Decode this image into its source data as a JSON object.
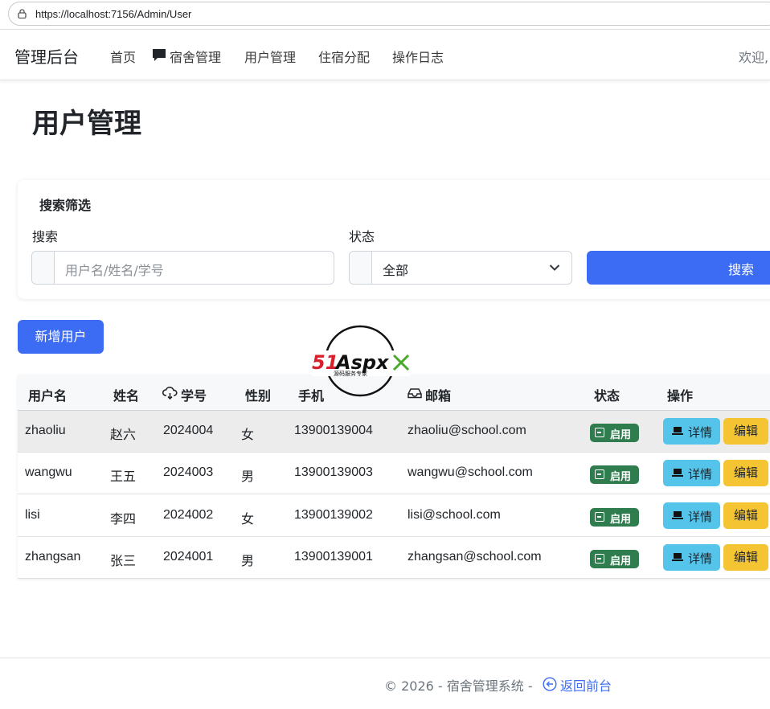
{
  "browser": {
    "url": "https://localhost:7156/Admin/User"
  },
  "navbar": {
    "brand": "管理后台",
    "items": [
      {
        "label": "首页",
        "icon": ""
      },
      {
        "label": "宿舍管理",
        "icon": "chat-bubble-icon"
      },
      {
        "label": "用户管理",
        "icon": ""
      },
      {
        "label": "住宿分配",
        "icon": ""
      },
      {
        "label": "操作日志",
        "icon": ""
      }
    ],
    "welcome": "欢迎,"
  },
  "page": {
    "title": "用户管理"
  },
  "filter": {
    "title": "搜索筛选",
    "search_label": "搜索",
    "search_placeholder": "用户名/姓名/学号",
    "status_label": "状态",
    "status_value": "全部",
    "search_button": "搜索"
  },
  "actions": {
    "add_user": "新增用户"
  },
  "table": {
    "headers": {
      "username": "用户名",
      "name": "姓名",
      "student_id": "学号",
      "gender": "性别",
      "phone": "手机",
      "email": "邮箱",
      "status": "状态",
      "ops": "操作"
    },
    "rows": [
      {
        "username": "zhaoliu",
        "name": "赵六",
        "student_id": "2024004",
        "gender": "女",
        "phone": "13900139004",
        "email": "zhaoliu@school.com",
        "status": "启用",
        "detail": "详情",
        "edit": "编辑"
      },
      {
        "username": "wangwu",
        "name": "王五",
        "student_id": "2024003",
        "gender": "男",
        "phone": "13900139003",
        "email": "wangwu@school.com",
        "status": "启用",
        "detail": "详情",
        "edit": "编辑"
      },
      {
        "username": "lisi",
        "name": "李四",
        "student_id": "2024002",
        "gender": "女",
        "phone": "13900139002",
        "email": "lisi@school.com",
        "status": "启用",
        "detail": "详情",
        "edit": "编辑"
      },
      {
        "username": "zhangsan",
        "name": "张三",
        "student_id": "2024001",
        "gender": "男",
        "phone": "13900139001",
        "email": "zhangsan@school.com",
        "status": "启用",
        "detail": "详情",
        "edit": "编辑"
      }
    ]
  },
  "watermark": {
    "logo_text": "51Aspx",
    "logo_subtext": "源码服务专家"
  },
  "footer": {
    "copyright": "© 2026 - 宿舍管理系统 -",
    "back_link": "返回前台"
  },
  "colors": {
    "primary": "#3c6cf3",
    "success": "#2f7d4f",
    "info": "#55c4ea",
    "warning": "#f4c432"
  }
}
